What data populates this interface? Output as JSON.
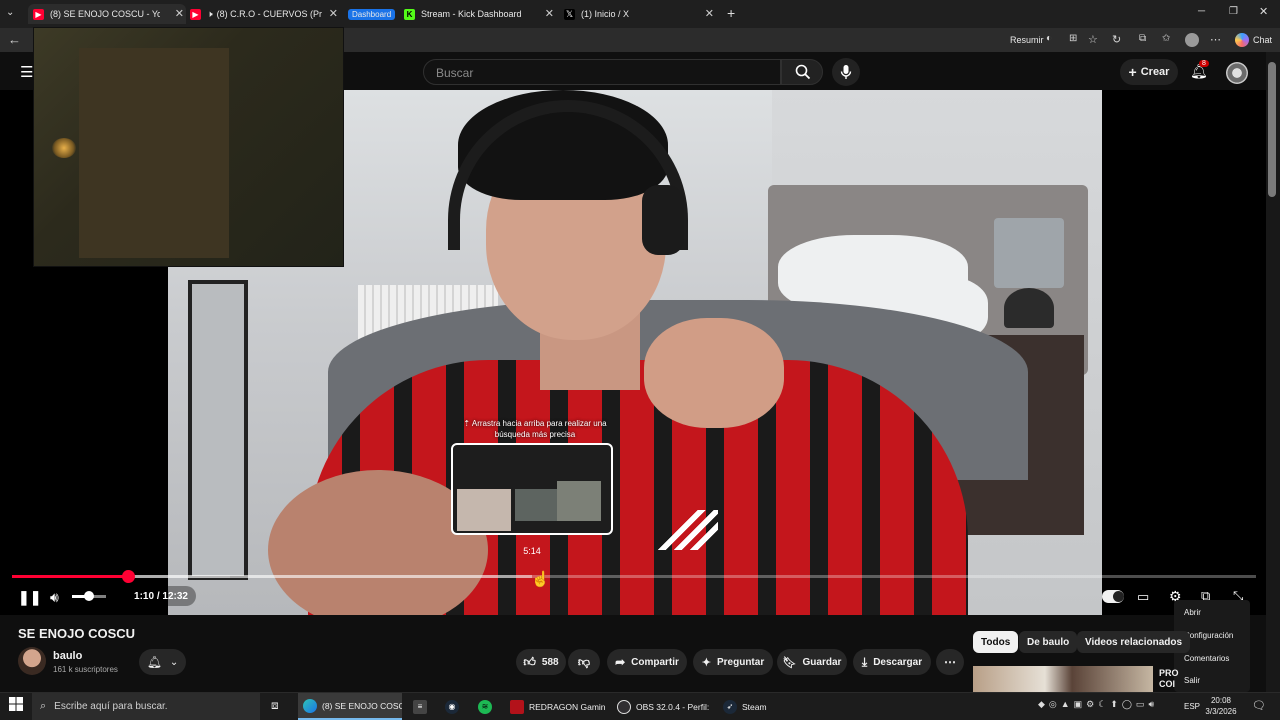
{
  "browser": {
    "tabs": [
      {
        "title": "(8) SE ENOJO COSCU - YouTube",
        "favicon": "youtube-icon",
        "active": true
      },
      {
        "title": "(8) C.R.O - CUERVOS (Prod. Ot",
        "favicon": "youtube-icon",
        "active": false
      },
      {
        "title": "Dashboard",
        "favicon": "",
        "active": false
      },
      {
        "title": "Stream - Kick Dashboard",
        "favicon": "kick-icon",
        "active": false
      },
      {
        "title": "(1) Inicio / X",
        "favicon": "x-icon",
        "active": false
      }
    ],
    "new_tab": "+",
    "toolbar": {
      "resumir": "Resumir",
      "chat": "Chat"
    }
  },
  "youtube": {
    "search_placeholder": "Buscar",
    "create_label": "Crear",
    "notifications_count": "8"
  },
  "player": {
    "scrub_hint": "⇡ Arrastra hacia arriba para realizar una búsqueda más precisa",
    "scrub_time": "5:14",
    "time_display": "1:10 / 12:32",
    "current_time": "1:10",
    "duration": "12:32",
    "progress": 0.093,
    "buffered": 0.175,
    "hover_position": 0.418,
    "volume": 0.5,
    "accent_color": "#ff0033"
  },
  "context_menu": {
    "items": [
      "Abrir",
      "Configuración",
      "Comentarios",
      "Salir"
    ]
  },
  "video": {
    "title": "SE ENOJO COSCU",
    "channel": "baulo",
    "subscribers": "161 k suscriptores",
    "likes": "588",
    "share_label": "Compartir",
    "ask_label": "Preguntar",
    "save_label": "Guardar",
    "download_label": "Descargar"
  },
  "related": {
    "chips": [
      "Todos",
      "De baulo",
      "Videos relacionados"
    ],
    "first_title_line1": "PRO",
    "first_title_line2": "COI"
  },
  "taskbar": {
    "search_placeholder": "Escribe aquí para buscar.",
    "apps": [
      {
        "label": "(8) SE ENOJO COSC...",
        "icon": "edge-icon",
        "active": true
      },
      {
        "label": "",
        "icon": "file-icon"
      },
      {
        "label": "",
        "icon": "steam-small-icon"
      },
      {
        "label": "",
        "icon": "spotify-icon"
      },
      {
        "label": "REDRAGON Gamin...",
        "icon": "redragon-icon"
      },
      {
        "label": "OBS 32.0.4 - Perfil: ...",
        "icon": "obs-icon"
      },
      {
        "label": "Steam",
        "icon": "steam-icon"
      }
    ],
    "language": "ESP",
    "time": "20:08",
    "date": "3/3/2026"
  }
}
